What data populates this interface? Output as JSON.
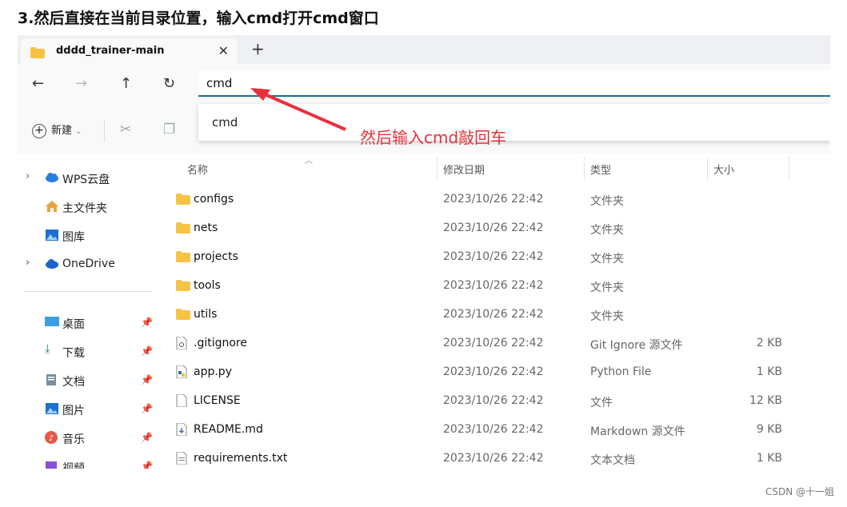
{
  "heading": "3.然后直接在当前目录位置，输入cmd打开cmd窗口",
  "tab": {
    "title": "dddd_trainer-main",
    "close": "✕"
  },
  "new_tab": "+",
  "nav": {
    "back": "←",
    "forward": "→",
    "up": "↑",
    "refresh": "↻"
  },
  "address": {
    "value": "cmd"
  },
  "suggestion": "cmd",
  "annotation": "然后输入cmd敲回车",
  "toolbar": {
    "new_label": "新建"
  },
  "sidebar": {
    "items": [
      {
        "label": "WPS云盘",
        "icon": "cloud-icon"
      },
      {
        "label": "主文件夹",
        "icon": "home-icon"
      },
      {
        "label": "图库",
        "icon": "gallery-icon"
      },
      {
        "label": "OneDrive",
        "icon": "cloud-icon"
      }
    ],
    "quick": [
      {
        "label": "桌面",
        "icon": "desktop-icon"
      },
      {
        "label": "下载",
        "icon": "download-icon"
      },
      {
        "label": "文档",
        "icon": "document-icon"
      },
      {
        "label": "图片",
        "icon": "picture-icon"
      },
      {
        "label": "音乐",
        "icon": "music-icon"
      },
      {
        "label": "视频",
        "icon": "video-icon"
      }
    ]
  },
  "columns": {
    "name": "名称",
    "date": "修改日期",
    "type": "类型",
    "size": "大小"
  },
  "files": [
    {
      "name": "configs",
      "date": "2023/10/26 22:42",
      "type": "文件夹",
      "size": "",
      "kind": "folder"
    },
    {
      "name": "nets",
      "date": "2023/10/26 22:42",
      "type": "文件夹",
      "size": "",
      "kind": "folder"
    },
    {
      "name": "projects",
      "date": "2023/10/26 22:42",
      "type": "文件夹",
      "size": "",
      "kind": "folder"
    },
    {
      "name": "tools",
      "date": "2023/10/26 22:42",
      "type": "文件夹",
      "size": "",
      "kind": "folder"
    },
    {
      "name": "utils",
      "date": "2023/10/26 22:42",
      "type": "文件夹",
      "size": "",
      "kind": "folder"
    },
    {
      "name": ".gitignore",
      "date": "2023/10/26 22:42",
      "type": "Git Ignore 源文件",
      "size": "2 KB",
      "kind": "gear-file"
    },
    {
      "name": "app.py",
      "date": "2023/10/26 22:42",
      "type": "Python File",
      "size": "1 KB",
      "kind": "python-file"
    },
    {
      "name": "LICENSE",
      "date": "2023/10/26 22:42",
      "type": "文件",
      "size": "12 KB",
      "kind": "file"
    },
    {
      "name": "README.md",
      "date": "2023/10/26 22:42",
      "type": "Markdown 源文件",
      "size": "9 KB",
      "kind": "markdown-file"
    },
    {
      "name": "requirements.txt",
      "date": "2023/10/26 22:42",
      "type": "文本文档",
      "size": "1 KB",
      "kind": "text-file"
    }
  ],
  "watermark": "CSDN @十一姐",
  "colors": {
    "accent": "#1c6f86",
    "annotation": "#e8303a",
    "folder": "#f6c344"
  }
}
